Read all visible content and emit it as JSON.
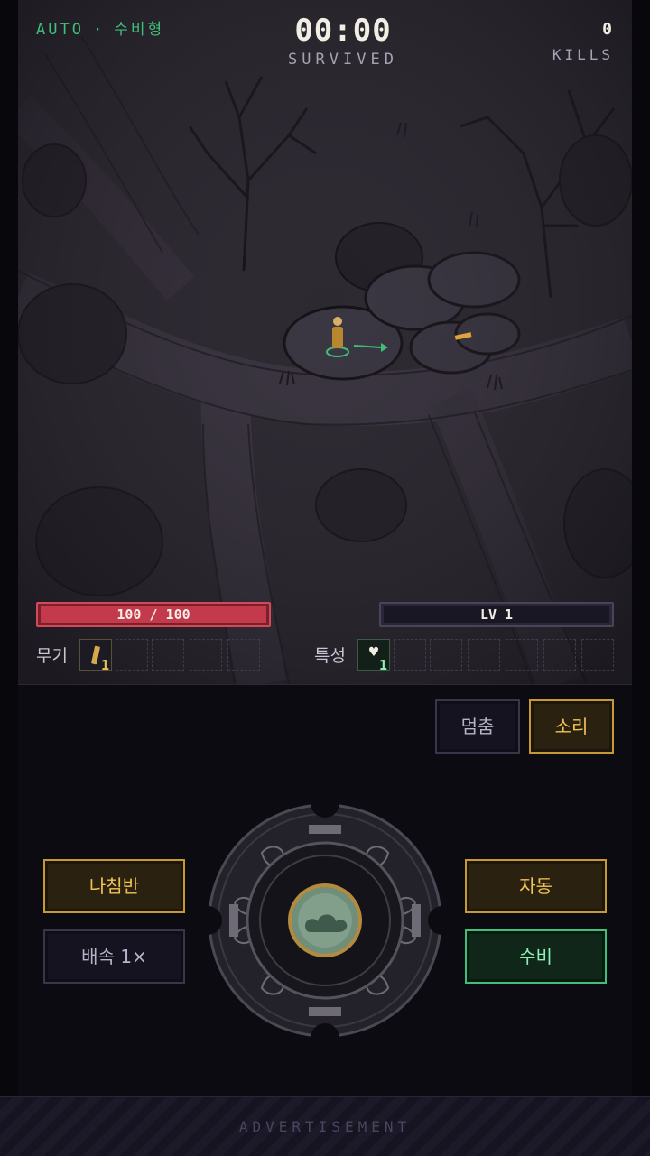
{
  "hud": {
    "mode": "AUTO",
    "separator": "·",
    "build": "수비형",
    "time": "00:00",
    "survived_label": "SURVIVED",
    "kills": "0",
    "kills_label": "KILLS"
  },
  "stats": {
    "hp_text": "100 / 100",
    "hp_fraction": 1.0,
    "level_text": "LV 1",
    "xp_fraction": 0.0
  },
  "slots": {
    "weapon_label": "무기",
    "weapon_count": "1",
    "trait_label": "특성",
    "trait_count": "1",
    "trait_icon": "♥"
  },
  "controls": {
    "pause": "멈춤",
    "sound": "소리",
    "compass": "나침반",
    "speed": "배속 1×",
    "auto": "자동",
    "defense": "수비"
  },
  "colors": {
    "accent_green": "#3fbf7a",
    "accent_gold": "#c59a35",
    "hp_red": "#c23a4b"
  },
  "ad": {
    "label": "ADVERTISEMENT"
  }
}
